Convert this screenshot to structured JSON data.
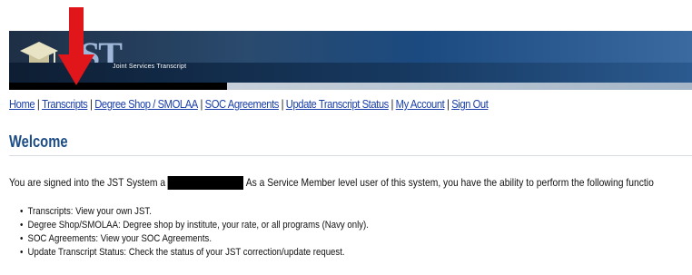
{
  "banner": {
    "logo_text": "JST",
    "subtitle": "Joint Services Transcript"
  },
  "nav": {
    "items": [
      {
        "label": "Home"
      },
      {
        "label": "Transcripts"
      },
      {
        "label": "Degree Shop / SMOLAA"
      },
      {
        "label": "SOC Agreements"
      },
      {
        "label": "Update Transcript Status"
      },
      {
        "label": "My Account"
      },
      {
        "label": "Sign Out"
      }
    ],
    "separator": "|"
  },
  "main": {
    "title": "Welcome",
    "intro_before": "You are signed into the JST System a",
    "intro_after": "As a Service Member level user of this system, you have the ability to perform the following functio",
    "features": [
      "Transcripts: View your own JST.",
      "Degree Shop/SMOLAA: Degree shop by institute, your rate, or all programs (Navy only).",
      "SOC Agreements: View your SOC Agreements.",
      "Update Transcript Status: Check the status of your JST correction/update request."
    ]
  },
  "colors": {
    "link": "#1a3fa8",
    "title": "#1c4c86",
    "arrow": "#e1161b",
    "banner": "#1e2f45"
  }
}
